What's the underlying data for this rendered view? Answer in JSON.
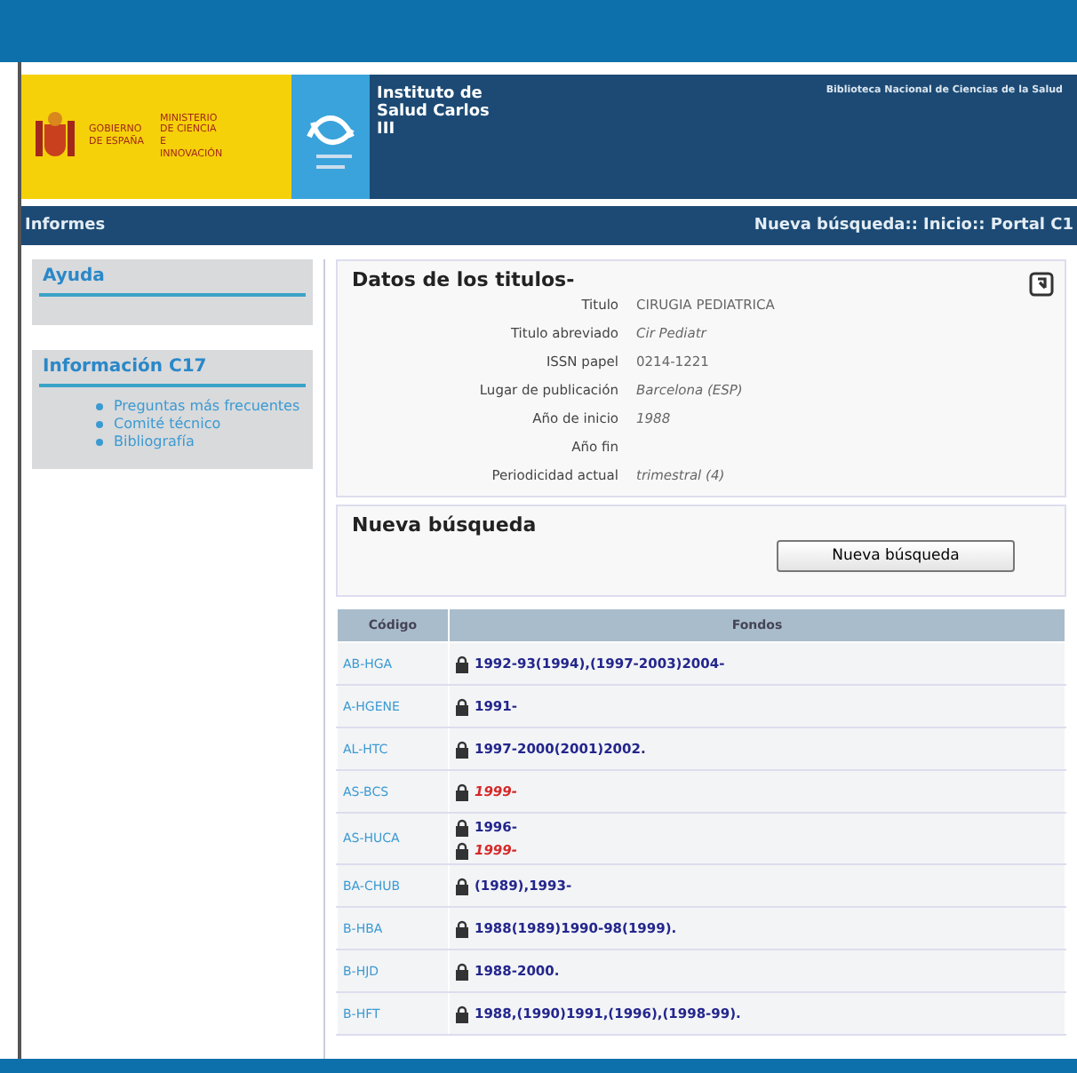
{
  "header": {
    "gov_name": "GOBIERNO DE ESPAÑA",
    "ministry": "MINISTERIO DE CIENCIA E INNOVACIÓN",
    "institute": "Instituto de Salud Carlos III",
    "library": "Biblioteca Nacional de Ciencias de la Salud"
  },
  "nav": {
    "left": "Informes",
    "right": "Nueva búsqueda:: Inicio:: Portal C1"
  },
  "sidebar": [
    {
      "title": "Ayuda"
    },
    {
      "title": "Información C17",
      "links": [
        "Preguntas más frecuentes",
        "Comité técnico",
        "Bibliografía"
      ]
    }
  ],
  "details": {
    "title": "Datos de los titulos-",
    "fields": [
      {
        "label": "Titulo",
        "value": "CIRUGIA PEDIATRICA",
        "italic": false
      },
      {
        "label": "Titulo abreviado",
        "value": "Cir Pediatr",
        "italic": true
      },
      {
        "label": "ISSN papel",
        "value": "0214-1221",
        "italic": false
      },
      {
        "label": "Lugar de publicación",
        "value": "Barcelona (ESP)",
        "italic": true
      },
      {
        "label": "Año de inicio",
        "value": "1988",
        "italic": true
      },
      {
        "label": "Año fin"
      },
      {
        "label": "Periodicidad actual",
        "value": "trimestral (4)",
        "italic": true
      }
    ]
  },
  "search": {
    "title": "Nueva búsqueda",
    "button": "Nueva búsqueda"
  },
  "table": {
    "columns": [
      "Código",
      "Fondos"
    ],
    "rows": [
      {
        "code": "AB-HGA",
        "holdings": [
          {
            "text": "1992-93(1994),(1997-2003)2004-",
            "kind": "held"
          }
        ]
      },
      {
        "code": "A-HGENE",
        "holdings": [
          {
            "text": "1991-",
            "kind": "held"
          }
        ]
      },
      {
        "code": "AL-HTC",
        "holdings": [
          {
            "text": "1997-2000(2001)2002.",
            "kind": "held"
          }
        ]
      },
      {
        "code": "AS-BCS",
        "holdings": [
          {
            "text": "1999-",
            "kind": "lapsed"
          }
        ]
      },
      {
        "code": "AS-HUCA",
        "holdings": [
          {
            "text": "1996-",
            "kind": "held"
          },
          {
            "text": "1999-",
            "kind": "lapsed"
          }
        ]
      },
      {
        "code": "BA-CHUB",
        "holdings": [
          {
            "text": "(1989),1993-",
            "kind": "held"
          }
        ]
      },
      {
        "code": "B-HBA",
        "holdings": [
          {
            "text": "1988(1989)1990-98(1999).",
            "kind": "held"
          }
        ]
      },
      {
        "code": "B-HJD",
        "holdings": [
          {
            "text": "1988-2000.",
            "kind": "held"
          }
        ]
      },
      {
        "code": "B-HFT",
        "holdings": [
          {
            "text": "1988,(1990)1991,(1996),(1998-99).",
            "kind": "held"
          }
        ]
      }
    ]
  }
}
